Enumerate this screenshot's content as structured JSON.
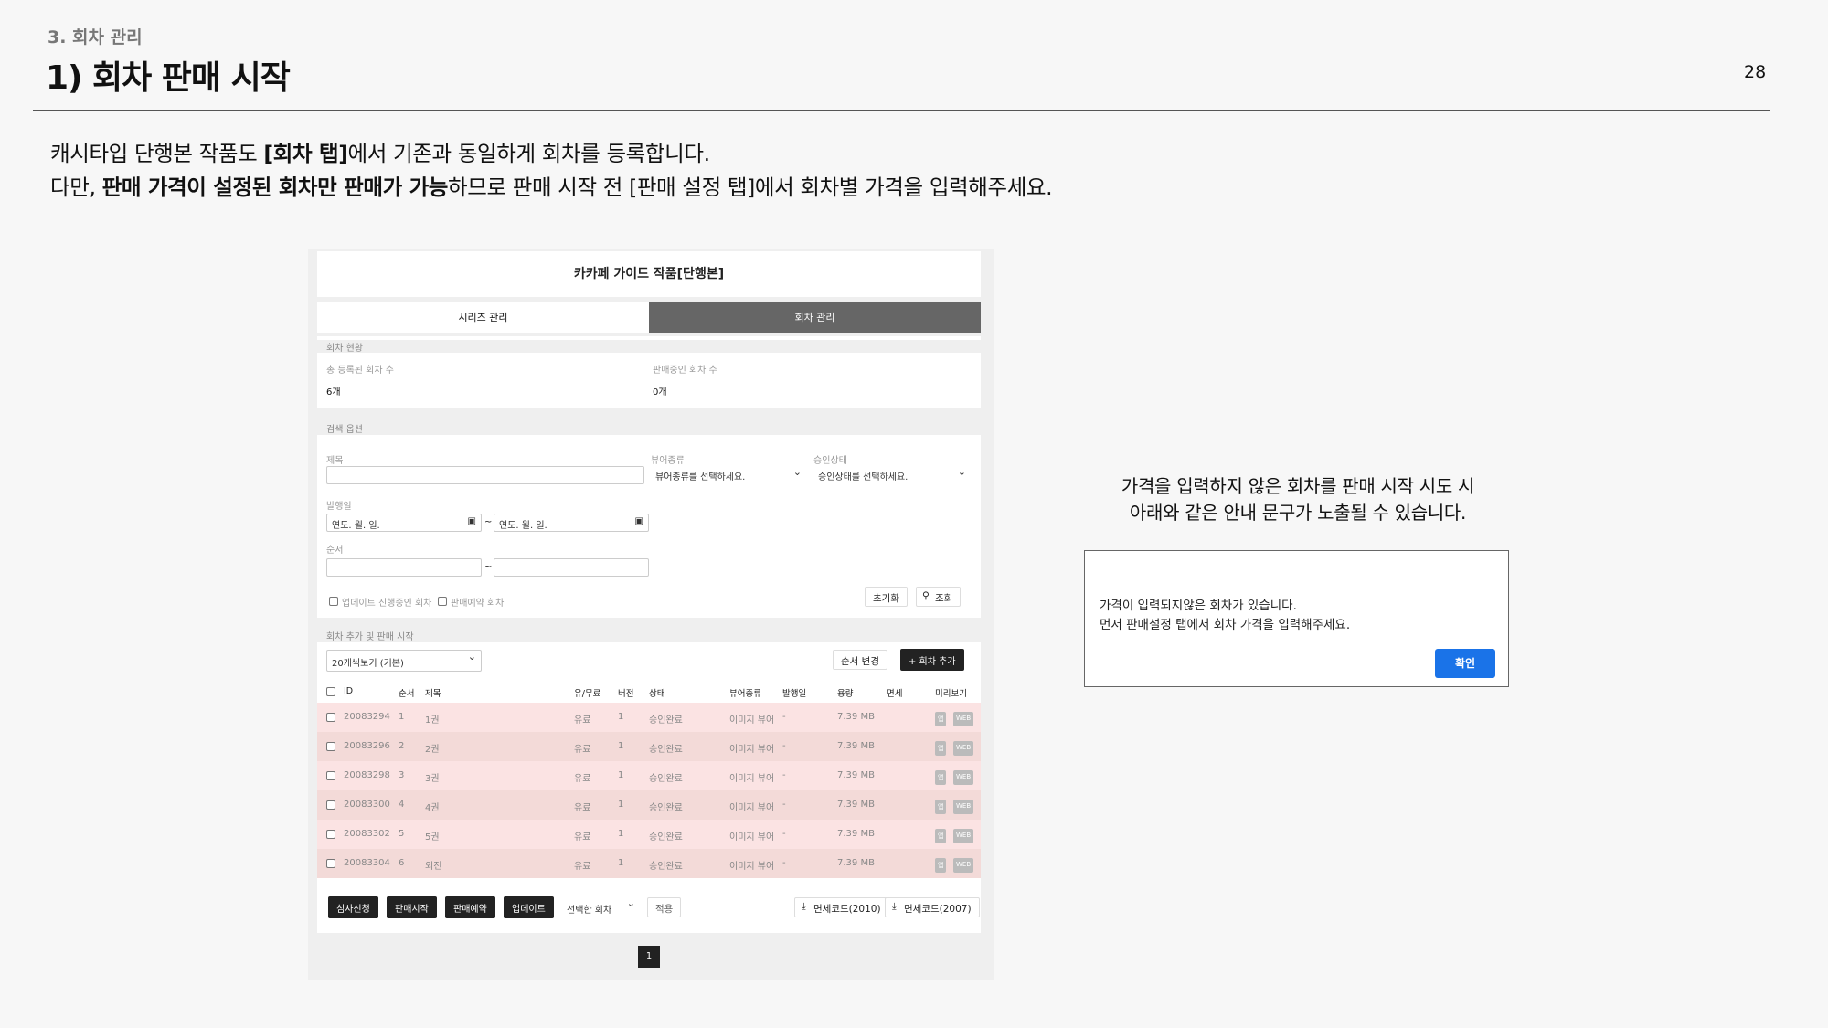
{
  "header": {
    "section": "3. 회차 관리",
    "title": "1) 회차 판매 시작",
    "page_number": "28"
  },
  "description": {
    "line1_a": "캐시타입 단행본 작품도 ",
    "line1_b": "[회차 탭]",
    "line1_c": "에서 기존과 동일하게 회차를 등록합니다.",
    "line2_a": "다만, ",
    "line2_b": "판매 가격이 설정된 회차만 판매가 가능",
    "line2_c": "하므로 판매 시작 전 [판매 설정 탭]에서 회차별 가격을 입력해주세요."
  },
  "screen": {
    "work_title": "카카페 가이드 작품[단행본]",
    "tabs": [
      {
        "label": "시리즈 관리"
      },
      {
        "label": "회차 관리"
      }
    ],
    "status": {
      "title": "회차 현황",
      "total_label": "총 등록된 회차 수",
      "total_value": "6개",
      "selling_label": "판매중인 회차 수",
      "selling_value": "0개"
    },
    "search": {
      "title": "검색 옵션",
      "title_label": "제목",
      "viewer_label": "뷰어종류",
      "viewer_placeholder": "뷰어종류를 선택하세요.",
      "approval_label": "승인상태",
      "approval_placeholder": "승인상태를 선택하세요.",
      "date_label": "발행일",
      "date_placeholder": "연도. 월. 일.",
      "tilde": "~",
      "order_label": "순서",
      "check_update": "업데이트 진행중인 회차",
      "check_reserve": "판매예약 회차",
      "reset": "초기화",
      "search": "조회"
    },
    "list": {
      "title": "회차 추가 및 판매 시작",
      "page_size": "20개씩보기 (기본)",
      "order_change": "순서 변경",
      "add": "+ 회차 추가",
      "columns": [
        "ID",
        "순서",
        "제목",
        "유/무료",
        "버전",
        "상태",
        "뷰어종류",
        "발행일",
        "용량",
        "면세",
        "미리보기"
      ],
      "rows": [
        {
          "id": "20083294",
          "order": "1",
          "title": "1권",
          "paid": "유료",
          "ver": "1",
          "status": "승인완료",
          "viewer": "이미지 뷰어",
          "date": "-",
          "size": "7.39 MB"
        },
        {
          "id": "20083296",
          "order": "2",
          "title": "2권",
          "paid": "유료",
          "ver": "1",
          "status": "승인완료",
          "viewer": "이미지 뷰어",
          "date": "-",
          "size": "7.39 MB"
        },
        {
          "id": "20083298",
          "order": "3",
          "title": "3권",
          "paid": "유료",
          "ver": "1",
          "status": "승인완료",
          "viewer": "이미지 뷰어",
          "date": "-",
          "size": "7.39 MB"
        },
        {
          "id": "20083300",
          "order": "4",
          "title": "4권",
          "paid": "유료",
          "ver": "1",
          "status": "승인완료",
          "viewer": "이미지 뷰어",
          "date": "-",
          "size": "7.39 MB"
        },
        {
          "id": "20083302",
          "order": "5",
          "title": "5권",
          "paid": "유료",
          "ver": "1",
          "status": "승인완료",
          "viewer": "이미지 뷰어",
          "date": "-",
          "size": "7.39 MB"
        },
        {
          "id": "20083304",
          "order": "6",
          "title": "외전",
          "paid": "유료",
          "ver": "1",
          "status": "승인완료",
          "viewer": "이미지 뷰어",
          "date": "-",
          "size": "7.39 MB"
        }
      ],
      "preview_app": "앱",
      "preview_web": "WEB",
      "actions": [
        "심사신청",
        "판매시작",
        "판매예약",
        "업데이트"
      ],
      "selected": "선택한 회차",
      "apply": "적용",
      "tax2010": "면세코드(2010)",
      "tax2007": "면세코드(2007)",
      "page": "1"
    }
  },
  "note": {
    "line1": "가격을 입력하지 않은 회차를 판매 시작 시도 시",
    "line2": "아래와 같은 안내 문구가 노출될 수 있습니다."
  },
  "dialog": {
    "line1": "가격이 입력되지않은 회차가 있습니다.",
    "line2": "먼저 판매설정 탭에서 회차 가격을 입력해주세요.",
    "confirm": "확인"
  },
  "colors": {
    "row_a": "#fbe3e3",
    "row_b": "#f3dad8",
    "confirm": "#1a73e8",
    "tab_active": "#666666"
  }
}
